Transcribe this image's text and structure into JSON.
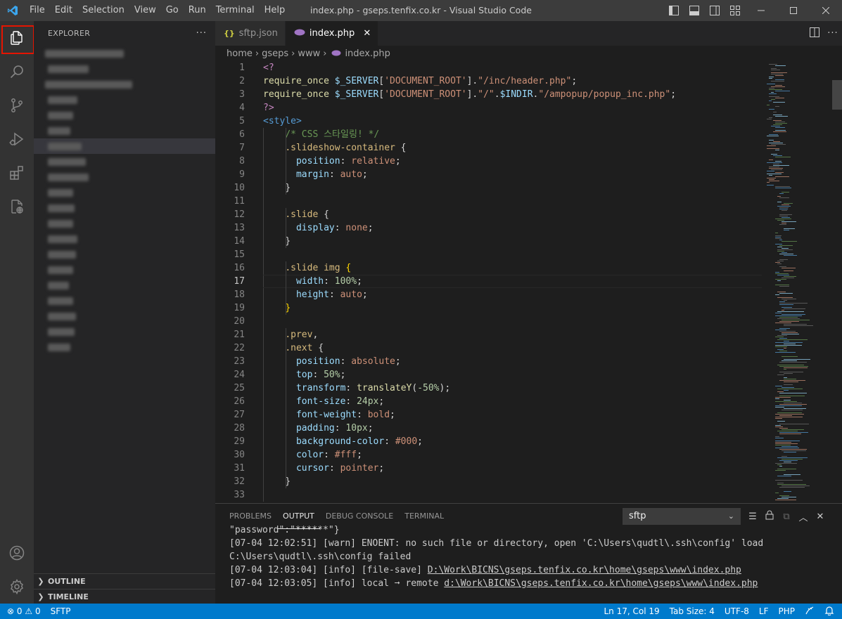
{
  "titlebar": {
    "menu": [
      "File",
      "Edit",
      "Selection",
      "View",
      "Go",
      "Run",
      "Terminal",
      "Help"
    ],
    "title": "index.php - gseps.tenfix.co.kr - Visual Studio Code"
  },
  "sidebar": {
    "title": "EXPLORER",
    "more": "···",
    "outline": "OUTLINE",
    "timeline": "TIMELINE"
  },
  "tabs": [
    {
      "icon": "{}",
      "label": "sftp.json"
    },
    {
      "icon": "php-icon",
      "label": "index.php",
      "close": "✕"
    }
  ],
  "breadcrumb": [
    "home",
    "gseps",
    "www",
    "index.php"
  ],
  "editor": {
    "current_line": 17,
    "lines": [
      [
        [
          "php",
          "<?"
        ]
      ],
      [
        [
          "fn",
          "require_once "
        ],
        [
          "var",
          "$_SERVER"
        ],
        [
          "punc",
          "["
        ],
        [
          "str",
          "'DOCUMENT_ROOT'"
        ],
        [
          "punc",
          "]."
        ],
        [
          "str",
          "\"/inc/header.php\""
        ],
        [
          "punc",
          ";"
        ]
      ],
      [
        [
          "fn",
          "require_once "
        ],
        [
          "var",
          "$_SERVER"
        ],
        [
          "punc",
          "["
        ],
        [
          "str",
          "'DOCUMENT_ROOT'"
        ],
        [
          "punc",
          "]."
        ],
        [
          "str",
          "\"/\""
        ],
        [
          "punc",
          "."
        ],
        [
          "var",
          "$INDIR"
        ],
        [
          "punc",
          "."
        ],
        [
          "str",
          "\"/ampopup/popup_inc.php\""
        ],
        [
          "punc",
          ";"
        ]
      ],
      [
        [
          "php",
          "?>"
        ]
      ],
      [
        [
          "tag",
          "<style>"
        ]
      ],
      [
        [
          "punc",
          "    "
        ],
        [
          "cmt",
          "/* CSS 스타일링! */"
        ]
      ],
      [
        [
          "punc",
          "    "
        ],
        [
          "sel",
          ".slideshow-container"
        ],
        [
          "punc",
          " {"
        ]
      ],
      [
        [
          "punc",
          "      "
        ],
        [
          "prop",
          "position"
        ],
        [
          "punc",
          ": "
        ],
        [
          "val",
          "relative"
        ],
        [
          "punc",
          ";"
        ]
      ],
      [
        [
          "punc",
          "      "
        ],
        [
          "prop",
          "margin"
        ],
        [
          "punc",
          ": "
        ],
        [
          "val",
          "auto"
        ],
        [
          "punc",
          ";"
        ]
      ],
      [
        [
          "punc",
          "    }"
        ]
      ],
      [
        [
          "punc",
          ""
        ]
      ],
      [
        [
          "punc",
          "    "
        ],
        [
          "sel",
          ".slide"
        ],
        [
          "punc",
          " {"
        ]
      ],
      [
        [
          "punc",
          "      "
        ],
        [
          "prop",
          "display"
        ],
        [
          "punc",
          ": "
        ],
        [
          "val",
          "none"
        ],
        [
          "punc",
          ";"
        ]
      ],
      [
        [
          "punc",
          "    }"
        ]
      ],
      [
        [
          "punc",
          ""
        ]
      ],
      [
        [
          "punc",
          "    "
        ],
        [
          "sel",
          ".slide img"
        ],
        [
          "punc",
          " "
        ],
        [
          "brk",
          "{"
        ]
      ],
      [
        [
          "punc",
          "      "
        ],
        [
          "prop",
          "width"
        ],
        [
          "punc",
          ": "
        ],
        [
          "num",
          "100%"
        ],
        [
          "punc",
          ";"
        ]
      ],
      [
        [
          "punc",
          "      "
        ],
        [
          "prop",
          "height"
        ],
        [
          "punc",
          ": "
        ],
        [
          "val",
          "auto"
        ],
        [
          "punc",
          ";"
        ]
      ],
      [
        [
          "punc",
          "    "
        ],
        [
          "brk",
          "}"
        ]
      ],
      [
        [
          "punc",
          ""
        ]
      ],
      [
        [
          "punc",
          "    "
        ],
        [
          "sel",
          ".prev"
        ],
        [
          "punc",
          ","
        ]
      ],
      [
        [
          "punc",
          "    "
        ],
        [
          "sel",
          ".next"
        ],
        [
          "punc",
          " {"
        ]
      ],
      [
        [
          "punc",
          "      "
        ],
        [
          "prop",
          "position"
        ],
        [
          "punc",
          ": "
        ],
        [
          "val",
          "absolute"
        ],
        [
          "punc",
          ";"
        ]
      ],
      [
        [
          "punc",
          "      "
        ],
        [
          "prop",
          "top"
        ],
        [
          "punc",
          ": "
        ],
        [
          "num",
          "50%"
        ],
        [
          "punc",
          ";"
        ]
      ],
      [
        [
          "punc",
          "      "
        ],
        [
          "prop",
          "transform"
        ],
        [
          "punc",
          ": "
        ],
        [
          "fn",
          "translateY"
        ],
        [
          "punc",
          "("
        ],
        [
          "num",
          "-50%"
        ],
        [
          "punc",
          ");"
        ]
      ],
      [
        [
          "punc",
          "      "
        ],
        [
          "prop",
          "font-size"
        ],
        [
          "punc",
          ": "
        ],
        [
          "num",
          "24px"
        ],
        [
          "punc",
          ";"
        ]
      ],
      [
        [
          "punc",
          "      "
        ],
        [
          "prop",
          "font-weight"
        ],
        [
          "punc",
          ": "
        ],
        [
          "val",
          "bold"
        ],
        [
          "punc",
          ";"
        ]
      ],
      [
        [
          "punc",
          "      "
        ],
        [
          "prop",
          "padding"
        ],
        [
          "punc",
          ": "
        ],
        [
          "num",
          "10px"
        ],
        [
          "punc",
          ";"
        ]
      ],
      [
        [
          "punc",
          "      "
        ],
        [
          "prop",
          "background-color"
        ],
        [
          "punc",
          ": "
        ],
        [
          "val",
          "#000"
        ],
        [
          "punc",
          ";"
        ]
      ],
      [
        [
          "punc",
          "      "
        ],
        [
          "prop",
          "color"
        ],
        [
          "punc",
          ": "
        ],
        [
          "val",
          "#fff"
        ],
        [
          "punc",
          ";"
        ]
      ],
      [
        [
          "punc",
          "      "
        ],
        [
          "prop",
          "cursor"
        ],
        [
          "punc",
          ": "
        ],
        [
          "val",
          "pointer"
        ],
        [
          "punc",
          ";"
        ]
      ],
      [
        [
          "punc",
          "    }"
        ]
      ],
      [
        [
          "punc",
          ""
        ]
      ]
    ]
  },
  "panel": {
    "tabs": [
      "PROBLEMS",
      "OUTPUT",
      "DEBUG CONSOLE",
      "TERMINAL"
    ],
    "active_tab": "OUTPUT",
    "channel": "sftp",
    "output": [
      "\"password\":\"******\"}",
      "[07-04 12:02:51] [warn] ENOENT: no such file or directory, open 'C:\\Users\\qudtl\\.ssh\\config' load",
      "C:\\Users\\qudtl\\.ssh\\config failed",
      "[07-04 12:03:04] [info] [file-save] |D:\\Work\\BICNS\\gseps.tenfix.co.kr\\home\\gseps\\www\\index.php",
      "[07-04 12:03:05] [info] local ➞ remote |d:\\Work\\BICNS\\gseps.tenfix.co.kr\\home\\gseps\\www\\index.php"
    ]
  },
  "status": {
    "errors": "0",
    "warnings": "0",
    "sftp": "SFTP",
    "position": "Ln 17, Col 19",
    "tabsize": "Tab Size: 4",
    "encoding": "UTF-8",
    "eol": "LF",
    "language": "PHP"
  }
}
